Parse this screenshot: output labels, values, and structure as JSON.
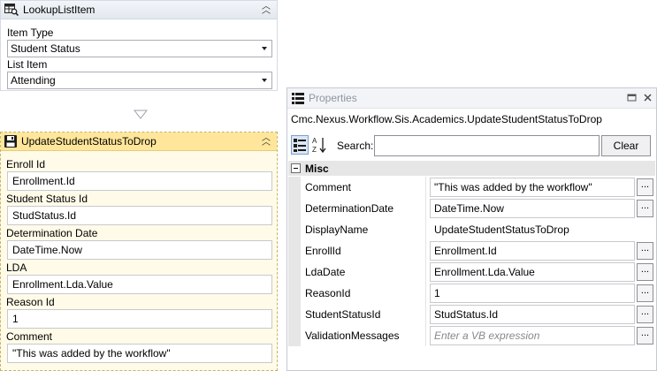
{
  "lookup_activity": {
    "title": "LookupListItem",
    "item_type_label": "Item Type",
    "item_type_value": "Student Status",
    "list_item_label": "List Item",
    "list_item_value": "Attending"
  },
  "update_activity": {
    "title": "UpdateStudentStatusToDrop",
    "fields": [
      {
        "label": "Enroll Id",
        "value": "Enrollment.Id"
      },
      {
        "label": "Student Status Id",
        "value": "StudStatus.Id"
      },
      {
        "label": "Determination Date",
        "value": "DateTime.Now"
      },
      {
        "label": "LDA",
        "value": "Enrollment.Lda.Value"
      },
      {
        "label": "Reason Id",
        "value": "1"
      },
      {
        "label": "Comment",
        "value": "\"This was added by the workflow\""
      }
    ]
  },
  "properties": {
    "title": "Properties",
    "type_name": "Cmc.Nexus.Workflow.Sis.Academics.UpdateStudentStatusToDrop",
    "search_label": "Search:",
    "clear_label": "Clear",
    "category": "Misc",
    "ellipsis": "...",
    "rows": [
      {
        "name": "Comment",
        "value": "\"This was added by the workflow\""
      },
      {
        "name": "DeterminationDate",
        "value": "DateTime.Now"
      },
      {
        "name": "DisplayName",
        "value": "UpdateStudentStatusToDrop"
      },
      {
        "name": "EnrollId",
        "value": "Enrollment.Id"
      },
      {
        "name": "LdaDate",
        "value": "Enrollment.Lda.Value"
      },
      {
        "name": "ReasonId",
        "value": "1"
      },
      {
        "name": "StudentStatusId",
        "value": "StudStatus.Id"
      },
      {
        "name": "ValidationMessages",
        "value": "Enter a VB expression"
      }
    ]
  },
  "icons": {
    "lookup": "lookup-table-icon",
    "update": "save-disk-icon",
    "properties": "properties-list-icon",
    "categorized": "categorized-view-icon",
    "sort": "sort-alphabetical-icon"
  },
  "colors": {
    "selected_activity_header": "#ffe69a",
    "selected_activity_body": "#fffbe8",
    "activity_header": "#e3e8ef"
  }
}
